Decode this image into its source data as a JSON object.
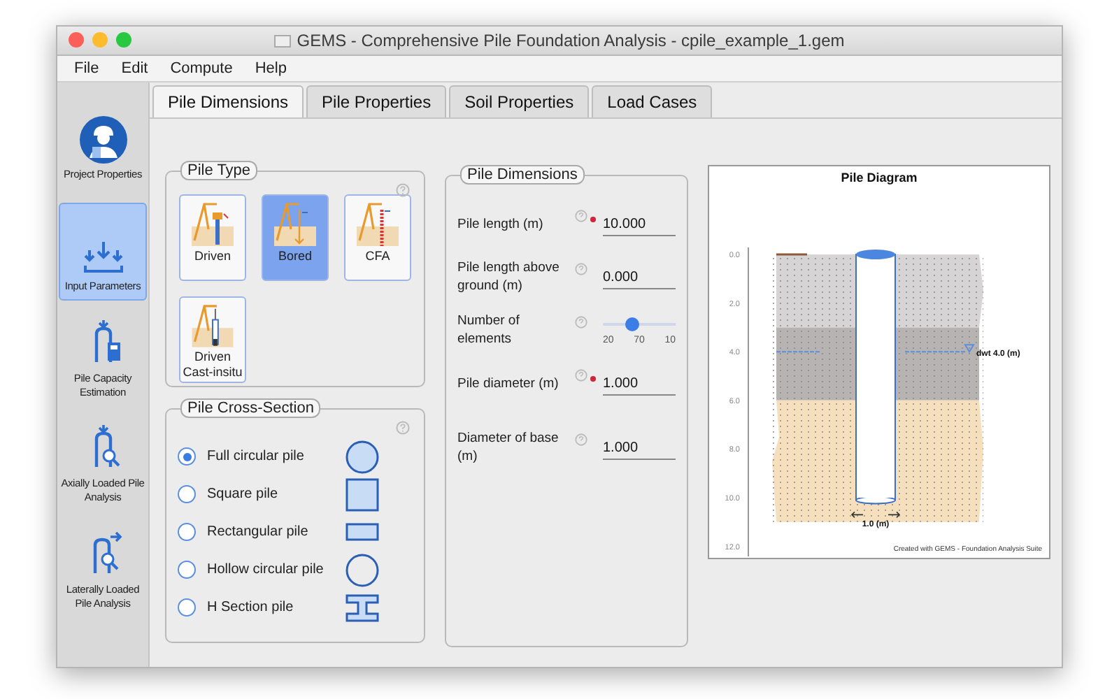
{
  "window": {
    "title": "GEMS - Comprehensive Pile Foundation Analysis - cpile_example_1.gem"
  },
  "menu": [
    "File",
    "Edit",
    "Compute",
    "Help"
  ],
  "sidebar": {
    "items": [
      {
        "label": "Project Properties",
        "kind": "person",
        "selected": false
      },
      {
        "label": "Input Parameters",
        "kind": "input",
        "selected": true
      },
      {
        "label": "Pile Capacity Estimation",
        "kind": "capacity",
        "selected": false
      },
      {
        "label": "Axially Loaded Pile Analysis",
        "kind": "axial",
        "selected": false
      },
      {
        "label": "Laterally Loaded Pile Analysis",
        "kind": "lateral",
        "selected": false
      }
    ]
  },
  "tabs": [
    {
      "label": "Pile Dimensions",
      "selected": true
    },
    {
      "label": "Pile Properties",
      "selected": false
    },
    {
      "label": "Soil Properties",
      "selected": false
    },
    {
      "label": "Load Cases",
      "selected": false
    }
  ],
  "pile_type": {
    "title": "Pile Type",
    "options": [
      {
        "label": "Driven",
        "kind": "driven",
        "selected": false
      },
      {
        "label": "Bored",
        "kind": "bored",
        "selected": true
      },
      {
        "label": "CFA",
        "kind": "cfa",
        "selected": false
      },
      {
        "label": "Driven Cast-insitu",
        "kind": "cast",
        "selected": false
      }
    ]
  },
  "cross_section": {
    "title": "Pile Cross-Section",
    "options": [
      {
        "label": "Full circular pile",
        "kind": "circle",
        "selected": true
      },
      {
        "label": "Square pile",
        "kind": "square",
        "selected": false
      },
      {
        "label": "Rectangular pile",
        "kind": "rectangle",
        "selected": false
      },
      {
        "label": "Hollow circular pile",
        "kind": "ring",
        "selected": false
      },
      {
        "label": "H Section pile",
        "kind": "h",
        "selected": false
      }
    ]
  },
  "dimensions": {
    "title": "Pile Dimensions",
    "rows": [
      {
        "kind": "field",
        "label": "Pile length (m)",
        "value": "10.000",
        "required": true
      },
      {
        "kind": "field",
        "label": "Pile length above ground (m)",
        "value": "0.000",
        "required": false
      },
      {
        "kind": "slider",
        "label": "Number of elements",
        "level": 0.4,
        "ticks": [
          "20",
          "70",
          "10"
        ]
      },
      {
        "kind": "field",
        "label": "Pile diameter (m)",
        "value": "1.000",
        "required": true
      },
      {
        "kind": "field",
        "label": "Diameter of base (m)",
        "value": "1.000",
        "required": false
      }
    ]
  },
  "diagram": {
    "title": "Pile Diagram",
    "depth_labels": [
      "0.0",
      "2.0",
      "4.0",
      "6.0",
      "8.0",
      "10.0",
      "12.0"
    ],
    "water_label": "dwt 4.0 (m)",
    "diameter_label": "1.0 (m)",
    "credit": "Created with GEMS - Foundation Analysis Suite"
  }
}
